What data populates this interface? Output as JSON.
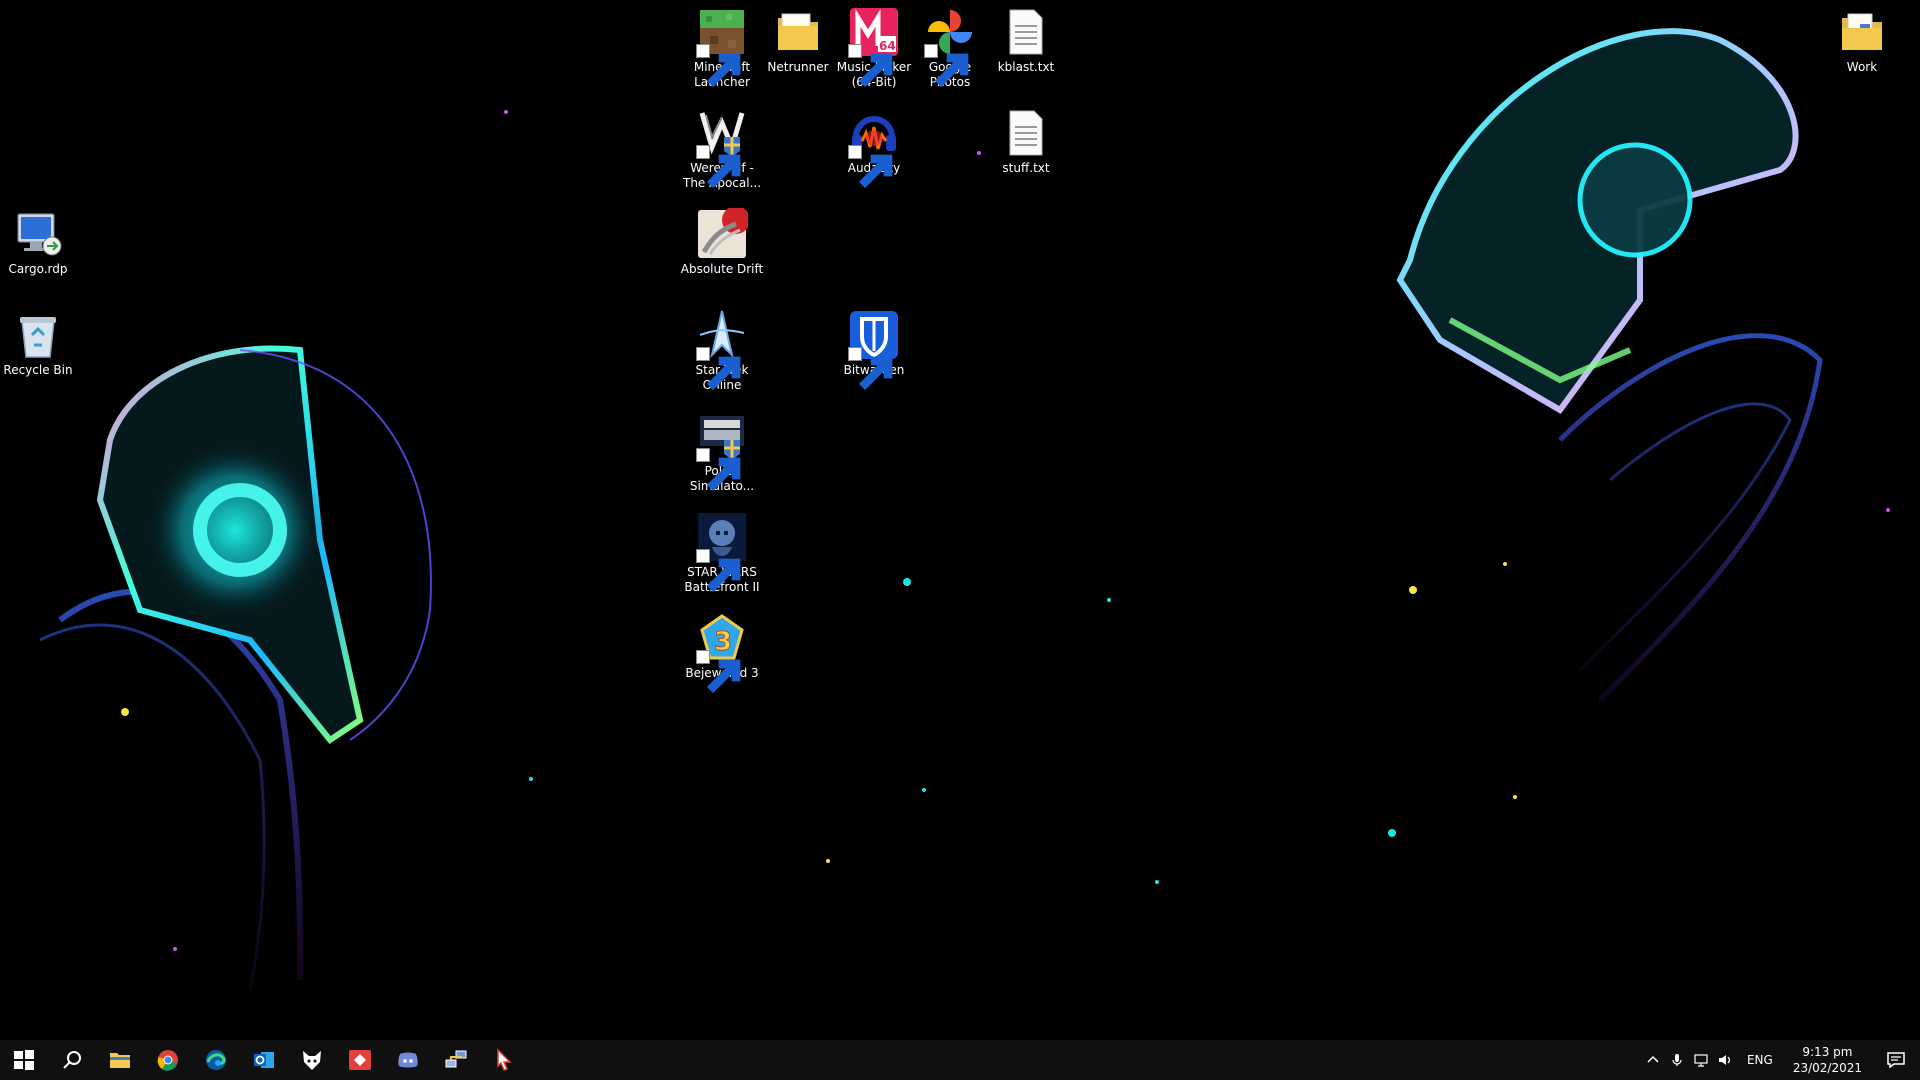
{
  "desktop": {
    "icons": [
      {
        "label": "Minecraft Launcher",
        "icon": "minecraft-icon"
      },
      {
        "label": "Netrunner",
        "icon": "folder-icon"
      },
      {
        "label": "Music Maker (64-Bit)",
        "icon": "music-maker-icon"
      },
      {
        "label": "Google Photos",
        "icon": "google-photos-icon"
      },
      {
        "label": "kblast.txt",
        "icon": "text-file-icon"
      },
      {
        "label": "Work",
        "icon": "folder-icon"
      },
      {
        "label": "Werewolf - The Apocal...",
        "icon": "werewolf-icon"
      },
      {
        "label": "Audacity",
        "icon": "audacity-icon"
      },
      {
        "label": "stuff.txt",
        "icon": "text-file-icon"
      },
      {
        "label": "Cargo.rdp",
        "icon": "remote-desktop-icon"
      },
      {
        "label": "Absolute Drift",
        "icon": "absolute-drift-icon"
      },
      {
        "label": "Recycle Bin",
        "icon": "recycle-bin-icon"
      },
      {
        "label": "Star Trek Online",
        "icon": "star-trek-icon"
      },
      {
        "label": "Bitwarden",
        "icon": "bitwarden-icon"
      },
      {
        "label": "Police Simulato...",
        "icon": "police-simulator-icon"
      },
      {
        "label": "STAR WARS Battlefront II",
        "icon": "star-wars-icon"
      },
      {
        "label": "Bejeweled 3",
        "icon": "bejeweled-icon"
      }
    ]
  },
  "taskbar": {
    "pinned": [
      {
        "name": "start-button",
        "icon": "windows-logo-icon"
      },
      {
        "name": "search-button",
        "icon": "search-icon"
      },
      {
        "name": "file-explorer",
        "icon": "folder-icon"
      },
      {
        "name": "chrome",
        "icon": "chrome-icon"
      },
      {
        "name": "edge",
        "icon": "edge-icon"
      },
      {
        "name": "outlook",
        "icon": "outlook-icon"
      },
      {
        "name": "fox-app",
        "icon": "fox-icon"
      },
      {
        "name": "red-app",
        "icon": "red-diamond-icon"
      },
      {
        "name": "discord",
        "icon": "discord-icon"
      },
      {
        "name": "network-app",
        "icon": "network-computer-icon"
      },
      {
        "name": "cursor-app",
        "icon": "cursor-icon"
      }
    ],
    "tray": {
      "language": "ENG",
      "time": "9:13 pm",
      "date": "23/02/2021"
    }
  },
  "colors": {
    "taskbar": "#101010",
    "accent_cyan": "#19e6e0",
    "folder_yellow": "#f2c94c"
  }
}
